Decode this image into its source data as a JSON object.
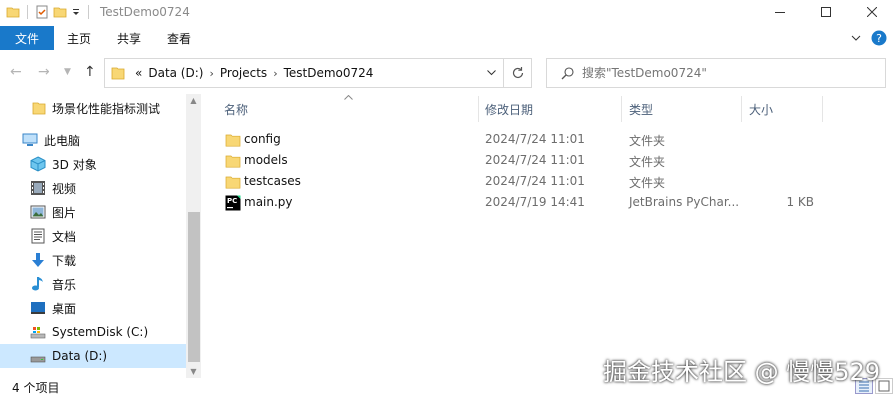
{
  "window": {
    "title": "TestDemo0724"
  },
  "ribbon": {
    "tabs": [
      "文件",
      "主页",
      "共享",
      "查看"
    ]
  },
  "address": {
    "overflow": "«",
    "crumbs": [
      "Data (D:)",
      "Projects",
      "TestDemo0724"
    ]
  },
  "search": {
    "placeholder": "搜索\"TestDemo0724\""
  },
  "sidebar": {
    "items": [
      {
        "label": "场景化性能指标测试",
        "icon": "folder-icon"
      },
      {
        "label": "此电脑",
        "icon": "computer-icon"
      },
      {
        "label": "3D 对象",
        "icon": "3d-objects-icon"
      },
      {
        "label": "视频",
        "icon": "video-icon"
      },
      {
        "label": "图片",
        "icon": "pictures-icon"
      },
      {
        "label": "文档",
        "icon": "documents-icon"
      },
      {
        "label": "下载",
        "icon": "download-icon"
      },
      {
        "label": "音乐",
        "icon": "music-icon"
      },
      {
        "label": "桌面",
        "icon": "desktop-icon"
      },
      {
        "label": "SystemDisk (C:)",
        "icon": "system-drive-icon"
      },
      {
        "label": "Data (D:)",
        "icon": "drive-icon"
      }
    ]
  },
  "columns": {
    "name": "名称",
    "date": "修改日期",
    "type": "类型",
    "size": "大小"
  },
  "files": [
    {
      "name": "config",
      "date": "2024/7/24 11:01",
      "type": "文件夹",
      "size": "",
      "icon": "folder-icon"
    },
    {
      "name": "models",
      "date": "2024/7/24 11:01",
      "type": "文件夹",
      "size": "",
      "icon": "folder-icon"
    },
    {
      "name": "testcases",
      "date": "2024/7/24 11:01",
      "type": "文件夹",
      "size": "",
      "icon": "folder-icon"
    },
    {
      "name": "main.py",
      "date": "2024/7/19 14:41",
      "type": "JetBrains PyChar...",
      "size": "1 KB",
      "icon": "pycharm-file-icon"
    }
  ],
  "status": {
    "count": "4 个项目"
  },
  "watermark": "掘金技术社区 @ 慢慢529",
  "colors": {
    "file_tab": "#1979ca",
    "selected": "#cce8ff",
    "folder": "#f8d775"
  }
}
